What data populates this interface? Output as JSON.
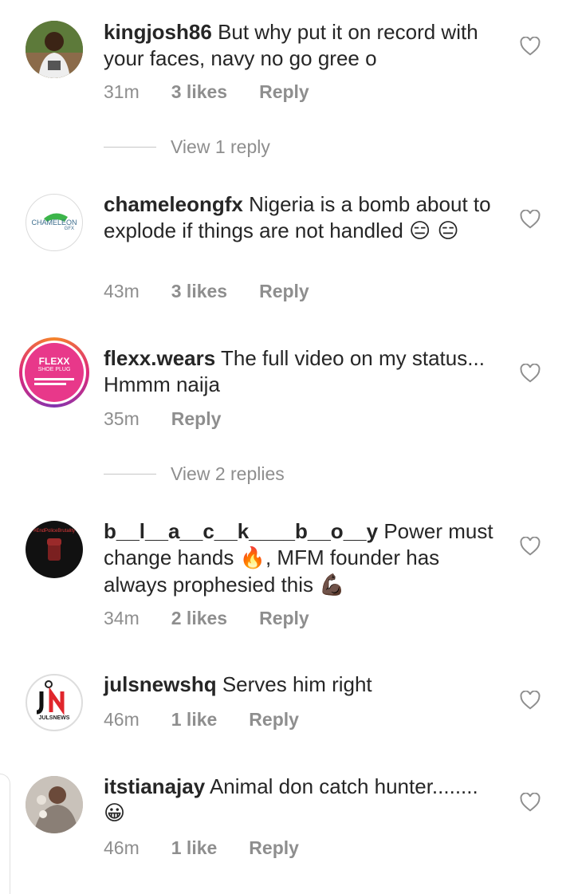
{
  "comments": [
    {
      "username": "kingjosh86",
      "text": "But why put it on record with your faces, navy no go gree o",
      "time": "31m",
      "likes": "3 likes",
      "reply": "Reply",
      "avatar_icon": "person-photo"
    },
    {
      "username": "chameleongfx",
      "text": "Nigeria is a bomb about to explode if things are not handled",
      "emoji": "😑 😑",
      "time": "43m",
      "likes": "3 likes",
      "reply": "Reply",
      "avatar_label": "CHAMELEON",
      "avatar_sub": "GFX"
    },
    {
      "username": "flexx.wears",
      "text": "The full video on my status... Hmmm naija",
      "time": "35m",
      "reply": "Reply",
      "avatar_label": "FLEXX",
      "avatar_sub": "SHOE PLUG"
    },
    {
      "username": "b__l__a__c__k____b__o__y",
      "text": "Power must change hands",
      "emoji_mid": "🔥",
      "text2": ", MFM founder has always prophesied this",
      "emoji_end": "💪🏿",
      "time": "34m",
      "likes": "2 likes",
      "reply": "Reply",
      "avatar_label": "#EndPoliceBrutality"
    },
    {
      "username": "julsnewshq",
      "text": "Serves him right",
      "time": "46m",
      "likes": "1 like",
      "reply": "Reply",
      "avatar_label": "JULSNEWS"
    },
    {
      "username": "itstianajay",
      "text": "Animal don catch hunter........",
      "emoji": "😀",
      "time": "46m",
      "likes": "1 like",
      "reply": "Reply",
      "avatar_icon": "person-photo"
    }
  ],
  "view_replies": [
    "View 1 reply",
    "View 2 replies"
  ],
  "colors": {
    "text": "#262626",
    "meta": "#8e8e8e",
    "heart": "#8e8e8e"
  }
}
